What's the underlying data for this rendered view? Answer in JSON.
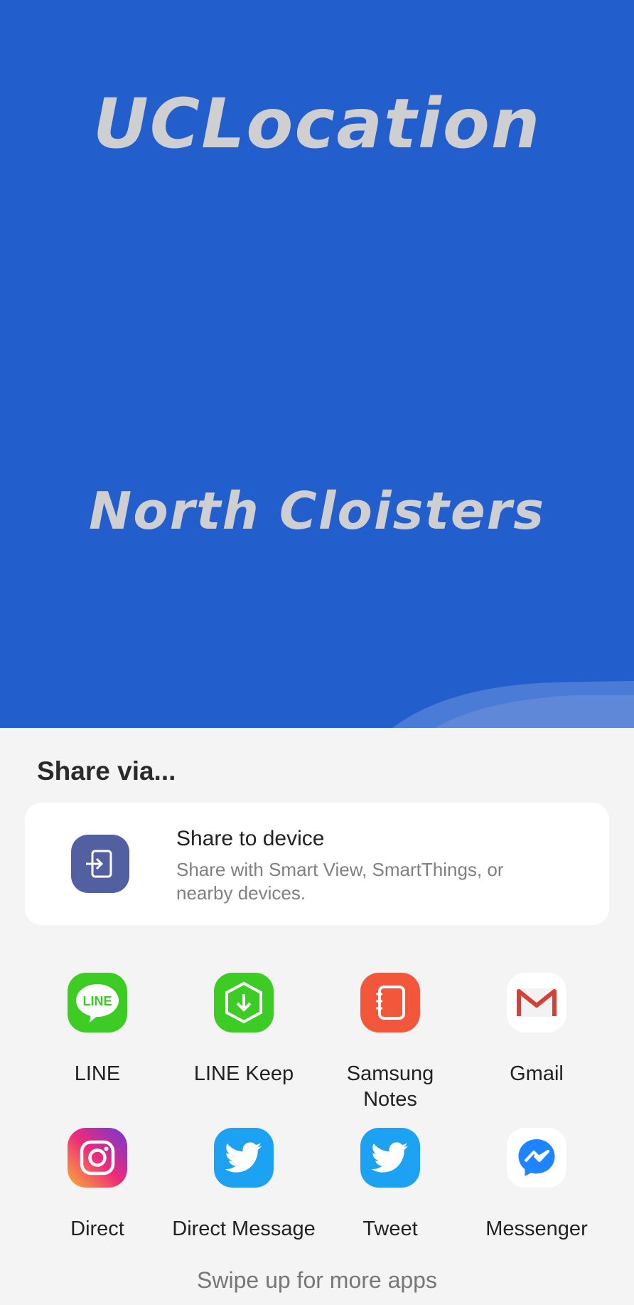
{
  "hero": {
    "app_title": "UCLocation",
    "location_name": "North Cloisters",
    "background_color": "#235fcc"
  },
  "share_sheet": {
    "title": "Share via...",
    "device": {
      "title": "Share to device",
      "subtitle": "Share with Smart View, SmartThings, or nearby devices.",
      "icon": "share-to-device-icon"
    },
    "apps": [
      {
        "label": "LINE",
        "icon": "line-icon"
      },
      {
        "label": "LINE Keep",
        "icon": "line-keep-icon"
      },
      {
        "label": "Samsung Notes",
        "icon": "samsung-notes-icon"
      },
      {
        "label": "Gmail",
        "icon": "gmail-icon"
      },
      {
        "label": "Direct",
        "icon": "instagram-icon"
      },
      {
        "label": "Direct Message",
        "icon": "twitter-icon"
      },
      {
        "label": "Tweet",
        "icon": "twitter-icon"
      },
      {
        "label": "Messenger",
        "icon": "messenger-icon"
      }
    ],
    "swipe_hint": "Swipe up for more apps"
  }
}
